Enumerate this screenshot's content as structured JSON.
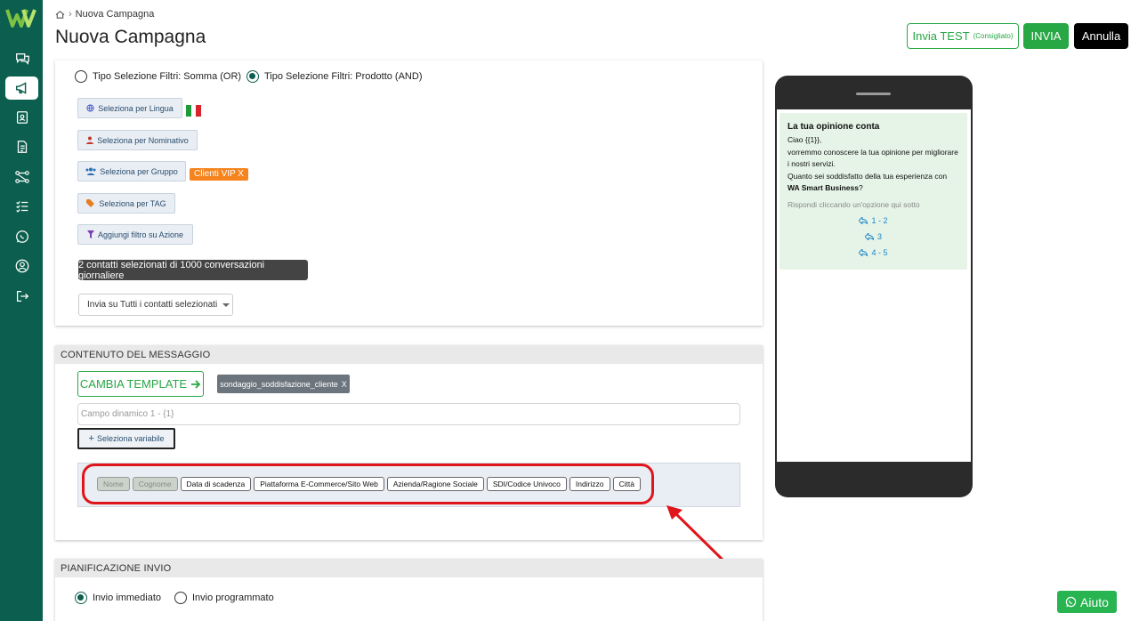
{
  "app": {
    "brand_color": "#0c5f4e",
    "accent": "#28a745"
  },
  "sidebar": {
    "items": [
      {
        "icon": "chat-icon"
      },
      {
        "icon": "megaphone-icon",
        "active": true
      },
      {
        "icon": "contacts-icon"
      },
      {
        "icon": "document-icon"
      },
      {
        "icon": "flow-icon"
      },
      {
        "icon": "checklist-icon"
      },
      {
        "icon": "whatsapp-icon"
      },
      {
        "icon": "user-icon"
      },
      {
        "icon": "logout-icon"
      }
    ]
  },
  "header": {
    "breadcrumb": "Nuova Campagna",
    "title": "Nuova Campagna",
    "test_label": "Invia TEST",
    "test_note": "(Consigliato)",
    "send_label": "INVIA",
    "cancel_label": "Annulla"
  },
  "filters": {
    "radio_or": "Tipo Selezione Filtri: Somma (OR)",
    "radio_and": "Tipo Selezione Filtri: Prodotto (AND)",
    "by_language": "Seleziona per Lingua",
    "by_name": "Seleziona per Nominativo",
    "by_group": "Seleziona per Gruppo",
    "group_tag": "Clienti VIP X",
    "by_tag": "Seleziona per TAG",
    "add_action_filter": "Aggiungi filtro su Azione",
    "selected_summary": "2 contatti selezionati di 1000 conversazioni giornaliere",
    "send_to_select": "Invia su Tutti i contatti selezionati"
  },
  "content": {
    "header": "CONTENUTO DEL MESSAGGIO",
    "change_template": "CAMBIA TEMPLATE",
    "template_name": "sondaggio_soddisfazione_cliente",
    "template_remove": "X",
    "dynamic_placeholder": "Campo dinamico 1 - {1}",
    "select_variable": "Seleziona variabile",
    "variables": [
      "Nome",
      "Cognome",
      "Data di scadenza",
      "Piattaforma E-Commerce/Sito Web",
      "Azienda/Ragione Sociale",
      "SDI/Codice Univoco",
      "Indirizzo",
      "Città"
    ]
  },
  "schedule": {
    "header": "PIANIFICAZIONE INVIO",
    "immediate": "Invio immediato",
    "scheduled": "Invio programmato"
  },
  "preview": {
    "title": "La tua opinione conta",
    "line1": "Ciao {{1}},",
    "line2": "vorremmo conoscere la tua opinione per migliorare i nostri servizi.",
    "line3": "Quanto sei soddisfatto della tua esperienza con",
    "brand": "WA Smart Business",
    "line3_end": "?",
    "hint": "Rispondi cliccando un'opzione qui sotto",
    "replies": [
      "1 - 2",
      "3",
      "4 - 5"
    ]
  },
  "help": {
    "label": "Aiuto"
  }
}
